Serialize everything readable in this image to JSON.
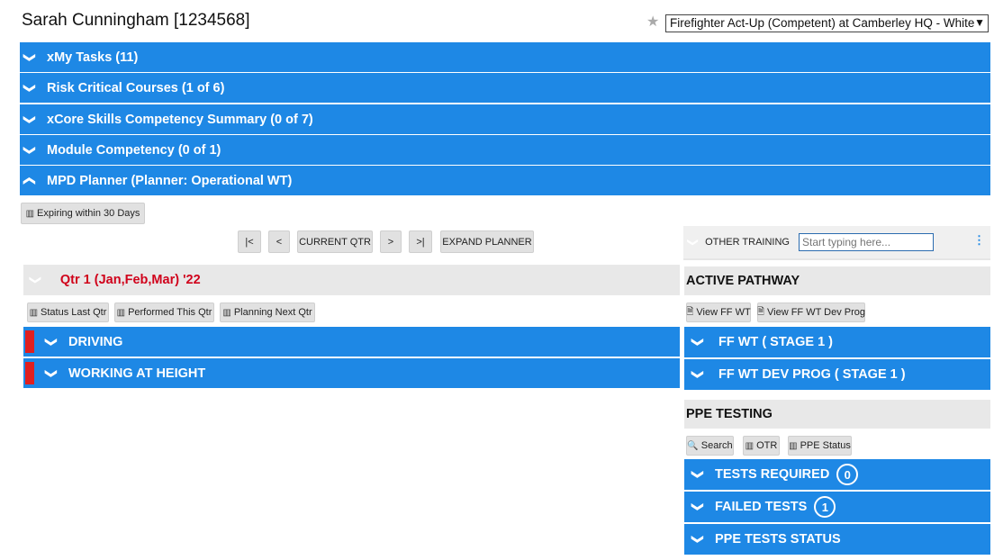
{
  "header": {
    "title": "Sarah Cunningham [1234568]",
    "role_select": "Firefighter Act-Up (Competent) at Camberley HQ - White"
  },
  "sections": [
    {
      "label": "xMy Tasks  (11)",
      "icon": "chevron-down-icon"
    },
    {
      "label": "Risk Critical Courses  (1 of 6)",
      "icon": "chevron-down-icon"
    },
    {
      "label": "xCore Skills Competency Summary  (0 of 7)",
      "icon": "chevron-down-icon"
    },
    {
      "label": "Module Competency  (0 of 1)",
      "icon": "chevron-down-icon"
    },
    {
      "label": "MPD Planner (Planner: Operational WT)",
      "icon": "chevron-up-icon"
    }
  ],
  "planner": {
    "expiring_button": "Expiring within 30 Days",
    "nav": {
      "first": "|<",
      "prev": "<",
      "current": "CURRENT QTR",
      "next": ">",
      "last": ">|",
      "expand": "EXPAND PLANNER"
    },
    "quarter_title": "Qtr 1 (Jan,Feb,Mar) '22",
    "quarter_buttons": [
      "Status Last Qtr",
      "Performed This Qtr",
      "Planning Next Qtr"
    ],
    "categories": [
      "DRIVING",
      "WORKING AT HEIGHT"
    ]
  },
  "other_training": {
    "label": "OTHER TRAINING",
    "placeholder": "Start typing here..."
  },
  "active_pathway": {
    "title": "ACTIVE PATHWAY",
    "buttons": [
      "View FF WT",
      "View FF WT Dev Prog"
    ],
    "items": [
      "FF WT  ( STAGE 1 )",
      "FF WT DEV PROG  ( STAGE 1 )"
    ]
  },
  "ppe_testing": {
    "title": "PPE TESTING",
    "buttons": [
      "Search",
      "OTR",
      "PPE Status"
    ],
    "items": [
      {
        "label": "TESTS REQUIRED",
        "count": "0"
      },
      {
        "label": "FAILED TESTS",
        "count": "1"
      },
      {
        "label": "PPE TESTS STATUS",
        "count": ""
      }
    ]
  },
  "colors": {
    "accent": "#1e88e5",
    "alert": "#d0021b",
    "panel": "#e8e8e8"
  }
}
